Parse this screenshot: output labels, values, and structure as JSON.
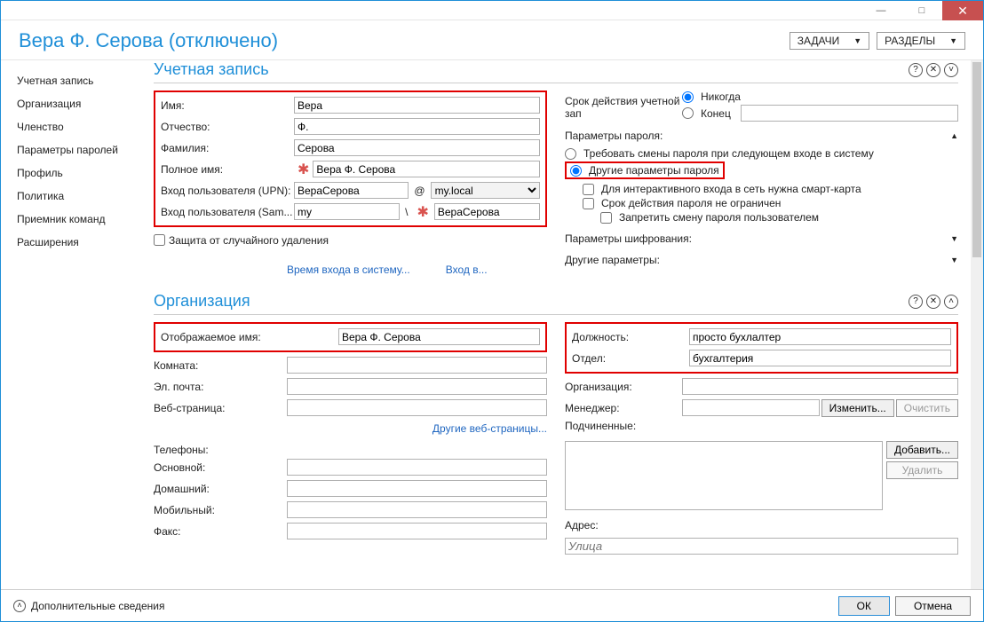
{
  "titlebar": {},
  "header": {
    "title": "Вера Ф. Серова (отключено)",
    "tasks_btn": "ЗАДАЧИ",
    "sections_btn": "РАЗДЕЛЫ"
  },
  "sidebar": {
    "items": [
      {
        "label": "Учетная запись"
      },
      {
        "label": "Организация"
      },
      {
        "label": "Членство"
      },
      {
        "label": "Параметры паролей"
      },
      {
        "label": "Профиль"
      },
      {
        "label": "Политика"
      },
      {
        "label": "Приемник команд"
      },
      {
        "label": "Расширения"
      }
    ]
  },
  "account": {
    "section_title": "Учетная запись",
    "firstname_lbl": "Имя:",
    "firstname": "Вера",
    "middlename_lbl": "Отчество:",
    "middlename": "Ф.",
    "lastname_lbl": "Фамилия:",
    "lastname": "Серова",
    "fullname_lbl": "Полное имя:",
    "fullname": "Вера Ф. Серова",
    "upn_lbl": "Вход пользователя (UPN):",
    "upn_user": "ВераСерова",
    "upn_domain": "my.local",
    "sam_lbl": "Вход пользователя (Sam...",
    "sam_domain": "my",
    "sam_user": "ВераСерова",
    "protect_lbl": "Защита от случайного удаления",
    "logon_hours_link": "Время входа в систему...",
    "logon_to_link": "Вход в...",
    "expiry_lbl": "Срок действия учетной зап",
    "never_lbl": "Никогда",
    "end_lbl": "Конец",
    "pwd_params_lbl": "Параметры пароля:",
    "pwd_change_next": "Требовать смены пароля при следующем входе в систему",
    "pwd_other": "Другие параметры пароля",
    "smartcard": "Для интерактивного входа в сеть нужна смарт-карта",
    "no_expire": "Срок действия пароля не ограничен",
    "no_change": "Запретить смену пароля пользователем",
    "enc_lbl": "Параметры шифрования:",
    "other_lbl": "Другие параметры:",
    "at": "@",
    "bs": "\\"
  },
  "org": {
    "section_title": "Организация",
    "display_lbl": "Отображаемое имя:",
    "display": "Вера Ф. Серова",
    "room_lbl": "Комната:",
    "email_lbl": "Эл. почта:",
    "web_lbl": "Веб-страница:",
    "other_web": "Другие веб-страницы...",
    "phones_hdr": "Телефоны:",
    "main_phone_lbl": "Основной:",
    "home_phone_lbl": "Домашний:",
    "mobile_lbl": "Мобильный:",
    "fax_lbl": "Факс:",
    "title_lbl": "Должность:",
    "title": "просто бухлалтер",
    "dept_lbl": "Отдел:",
    "dept": "бухгалтерия",
    "company_lbl": "Организация:",
    "manager_lbl": "Менеджер:",
    "edit_btn": "Изменить...",
    "clear_btn": "Очистить",
    "reports_lbl": "Подчиненные:",
    "add_btn": "Добавить...",
    "remove_btn": "Удалить",
    "address_lbl": "Адрес:",
    "street_ph": "Улица"
  },
  "footer": {
    "more": "Дополнительные сведения",
    "ok": "ОК",
    "cancel": "Отмена"
  }
}
